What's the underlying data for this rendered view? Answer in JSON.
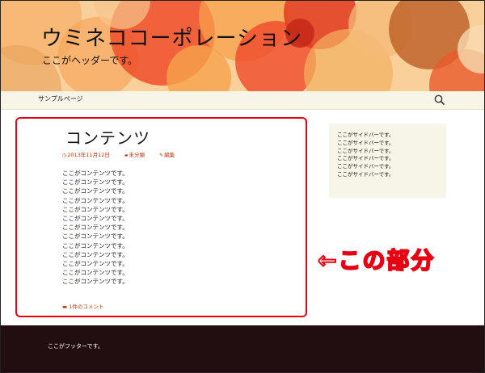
{
  "header": {
    "site_title": "ウミネココーポレーション",
    "site_description": "ここがヘッダーです。"
  },
  "nav": {
    "items": [
      {
        "label": "サンプルページ"
      }
    ],
    "search_icon": "search-icon"
  },
  "post": {
    "title": "コンテンツ",
    "meta": {
      "date": "2013年11月12日",
      "category": "未分類",
      "edit": "編集"
    },
    "content_lines": [
      "ここがコンテンツです。",
      "ここがコンテンツです。",
      "ここがコンテンツです。",
      "ここがコンテンツです。",
      "ここがコンテンツです。",
      "ここがコンテンツです。",
      "ここがコンテンツです。",
      "ここがコンテンツです。",
      "ここがコンテンツです。",
      "ここがコンテンツです。",
      "ここがコンテンツです。",
      "ここがコンテンツです。",
      "ここがコンテンツです。"
    ],
    "comments": "1件のコメント"
  },
  "sidebar": {
    "lines": [
      "ここがサイドバーです。",
      "ここがサイドバーです。",
      "ここがサイドバーです。",
      "ここがサイドバーです。",
      "ここがサイドバーです。",
      "ここがサイドバーです。"
    ]
  },
  "annotation": "←この部分",
  "footer": {
    "text": "ここがフッターです。"
  },
  "colors": {
    "accent": "#bc360a",
    "highlight": "#e60012",
    "footer_bg": "#220e10",
    "nav_bg": "#f7f5e7"
  }
}
